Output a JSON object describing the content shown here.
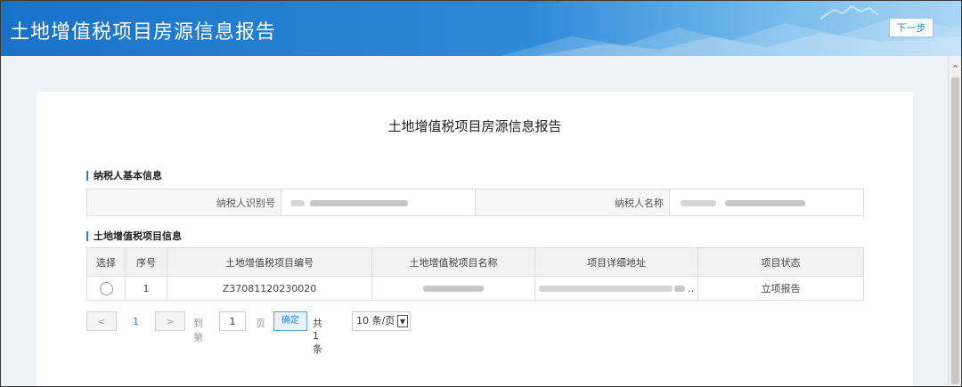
{
  "header": {
    "title": "土地增值税项目房源信息报告",
    "next_label": "下一步"
  },
  "report": {
    "title": "土地增值税项目房源信息报告"
  },
  "taxpayer_section": {
    "heading": "纳税人基本信息",
    "id_label": "纳税人识别号",
    "name_label": "纳税人名称"
  },
  "project_section": {
    "heading": "土地增值税项目信息",
    "columns": [
      "选择",
      "序号",
      "土地增值税项目编号",
      "土地增值税项目名称",
      "项目详细地址",
      "项目状态"
    ],
    "rows": [
      {
        "index": "1",
        "code": "Z37081120230020",
        "name": "",
        "address_suffix": "..",
        "status": "立项报告"
      }
    ]
  },
  "pager": {
    "prev": "<",
    "current": "1",
    "next": ">",
    "goto_label": "到第",
    "goto_value": "1",
    "page_unit": "页",
    "confirm_label": "确定",
    "total_label": "共 1 条",
    "page_size": "10 条/页"
  },
  "colors": {
    "header_blue": "#1a72c8",
    "accent": "#2a7fd4"
  },
  "icons": {
    "scroll_up": "chevron-up-icon",
    "select_arrow": "chevron-down-icon"
  }
}
